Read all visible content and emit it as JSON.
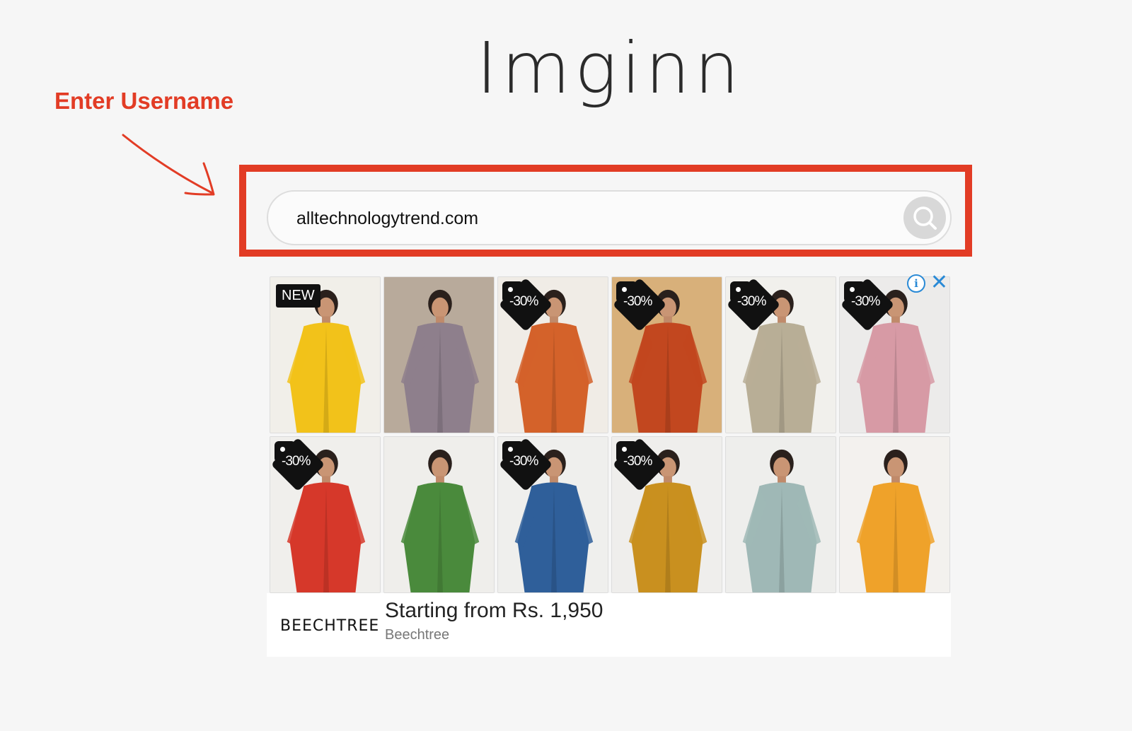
{
  "site": {
    "logo_text": "Imginn"
  },
  "annotation": {
    "label": "Enter Username",
    "color": "#e23c25"
  },
  "search": {
    "value": "alltechnologytrend.com",
    "button_icon": "search-icon"
  },
  "ad": {
    "info_icon": "info-icon",
    "close_icon": "close-icon",
    "products": [
      {
        "badge": "NEW",
        "badge_type": "new",
        "garment": "#f2c21a",
        "bg": "#f1efe9"
      },
      {
        "badge": "",
        "badge_type": "none",
        "garment": "#8e7f8c",
        "bg": "#b8aa9b"
      },
      {
        "badge": "-30%",
        "badge_type": "discount",
        "garment": "#d4622a",
        "bg": "#f0ece6"
      },
      {
        "badge": "-30%",
        "badge_type": "discount",
        "garment": "#c2471f",
        "bg": "#d8b07a"
      },
      {
        "badge": "-30%",
        "badge_type": "discount",
        "garment": "#b8ae96",
        "bg": "#f1f0ec"
      },
      {
        "badge": "-30%",
        "badge_type": "discount",
        "garment": "#d79aa5",
        "bg": "#ecebea"
      },
      {
        "badge": "-30%",
        "badge_type": "discount",
        "garment": "#d6382a",
        "bg": "#f0efec"
      },
      {
        "badge": "",
        "badge_type": "none",
        "garment": "#4a8a3c",
        "bg": "#efeeeb"
      },
      {
        "badge": "-30%",
        "badge_type": "discount",
        "garment": "#2f5f9a",
        "bg": "#efefed"
      },
      {
        "badge": "-30%",
        "badge_type": "discount",
        "garment": "#c9901f",
        "bg": "#efeeec"
      },
      {
        "badge": "",
        "badge_type": "none",
        "garment": "#9fb8b6",
        "bg": "#eeeeec"
      },
      {
        "badge": "",
        "badge_type": "none",
        "garment": "#efa22a",
        "bg": "#f3f1ee"
      }
    ],
    "brand": "BEECHTREE",
    "headline": "Starting from Rs. 1,950",
    "advertiser": "Beechtree"
  }
}
